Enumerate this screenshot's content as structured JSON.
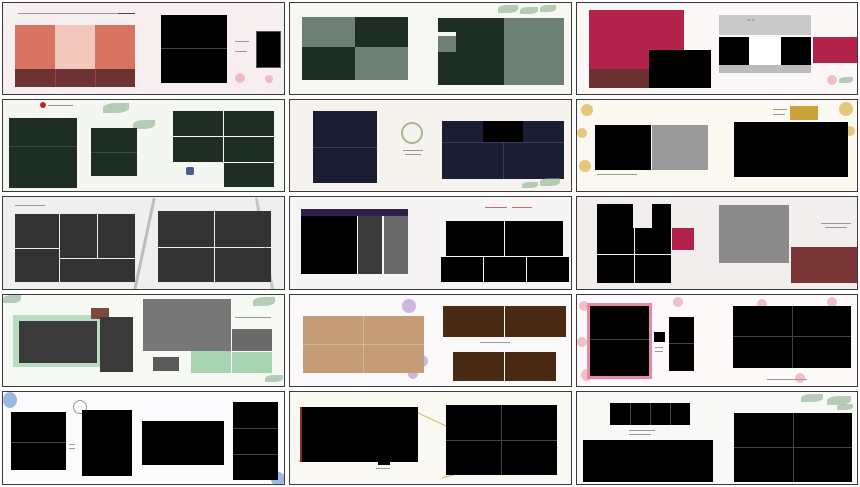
{
  "gallery": {
    "tiles": [
      {
        "id": 1,
        "theme": "pink-marble",
        "accent": "#d0705f"
      },
      {
        "id": 2,
        "theme": "greenery",
        "accent": "#6e8073"
      },
      {
        "id": 3,
        "theme": "crimson-floral",
        "accent": "#b3224b"
      },
      {
        "id": 4,
        "theme": "greenery-red-stamp",
        "accent": "#1f2e22"
      },
      {
        "id": 5,
        "theme": "navy-wreath",
        "accent": "#1b1d33"
      },
      {
        "id": 6,
        "theme": "gold-floral",
        "accent": "#c9a33a"
      },
      {
        "id": 7,
        "theme": "grey-branch",
        "accent": "#333333"
      },
      {
        "id": 8,
        "theme": "purple-banner-heart",
        "accent": "#2e2148"
      },
      {
        "id": 9,
        "theme": "marble-pink-brown",
        "accent": "#9a3a3a"
      },
      {
        "id": 10,
        "theme": "mint-greenery",
        "accent": "#a9d4b4"
      },
      {
        "id": 11,
        "theme": "lavender-tan",
        "accent": "#c49c76"
      },
      {
        "id": 12,
        "theme": "pink-blossom",
        "accent": "#e789a6"
      },
      {
        "id": 13,
        "theme": "blue-floral-wreath",
        "accent": "#5b8fc9"
      },
      {
        "id": 14,
        "theme": "gold-line",
        "accent": "#d6b86b"
      },
      {
        "id": 15,
        "theme": "green-leaves",
        "accent": "#7fa884"
      }
    ]
  }
}
